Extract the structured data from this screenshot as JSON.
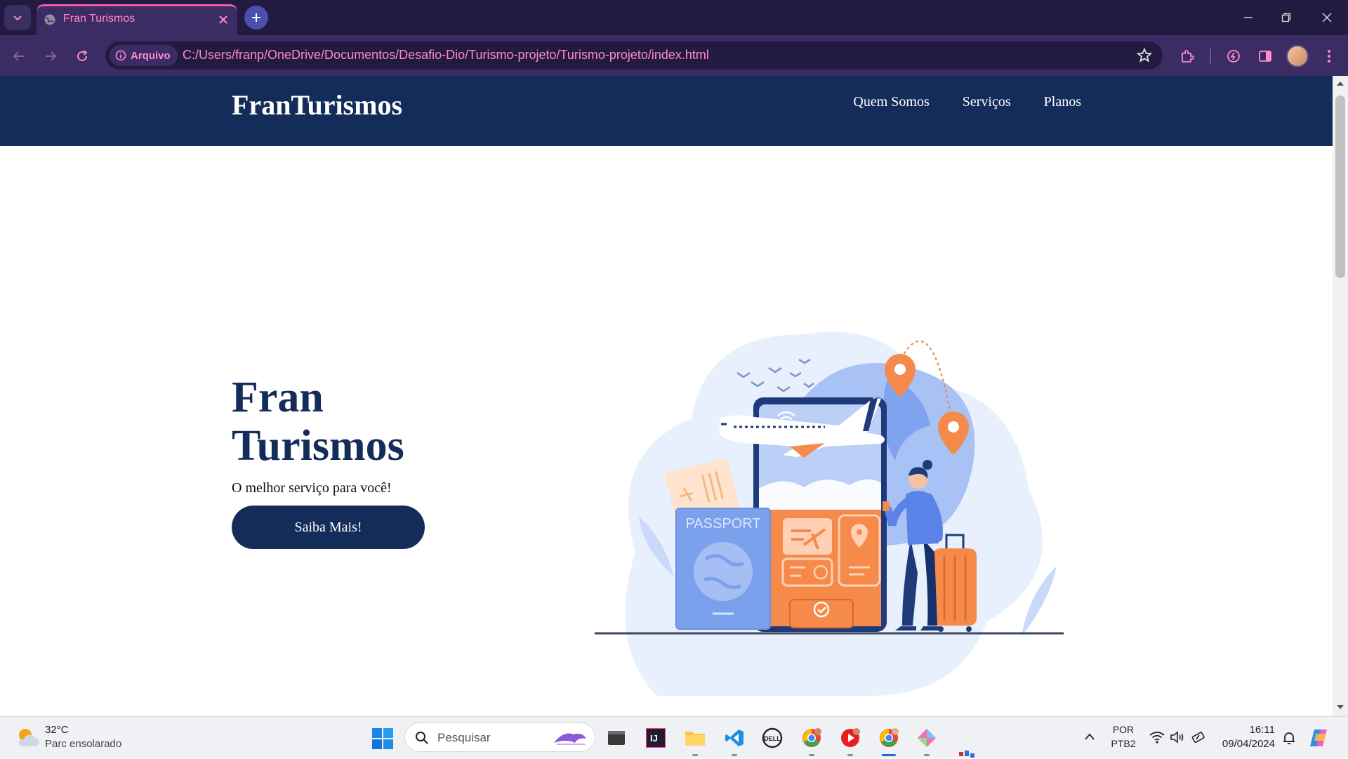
{
  "browser": {
    "tab_title": "Fran Turismos",
    "address_chip": "Arquivo",
    "url": "C:/Users/franp/OneDrive/Documentos/Desafio-Dio/Turismo-projeto/Turismo-projeto/index.html",
    "accent_color": "#ff8ac8",
    "chrome_color": "#221a40"
  },
  "site": {
    "logo": "FranTurismos",
    "nav": [
      "Quem Somos",
      "Serviços",
      "Planos"
    ],
    "hero": {
      "title_line1": "Fran",
      "title_line2": "Turismos",
      "subtitle": "O melhor serviço para você!",
      "button": "Saiba Mais!"
    },
    "illustration": {
      "passport_label": "PASSPORT"
    },
    "brand_color": "#142c5a"
  },
  "taskbar": {
    "weather_temp": "32°C",
    "weather_desc": "Parc ensolarado",
    "search_placeholder": "Pesquisar",
    "lang_line1": "POR",
    "lang_line2": "PTB2",
    "time": "16:11",
    "date": "09/04/2024",
    "apps": [
      "windows-terminal",
      "intellij-idea",
      "file-explorer",
      "vscode",
      "dell",
      "chrome-profile-1",
      "youtube-music",
      "chrome-profile-2",
      "git-kraken"
    ]
  }
}
